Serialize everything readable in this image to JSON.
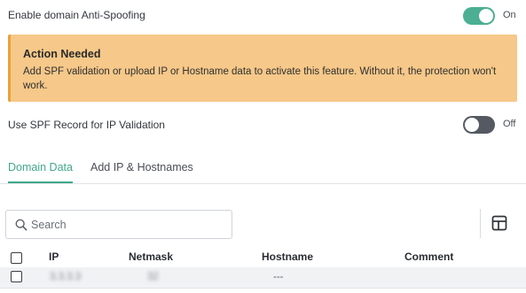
{
  "anti_spoofing": {
    "label": "Enable domain Anti-Spoofing",
    "state_text": "On",
    "enabled": true
  },
  "alert": {
    "title": "Action Needed",
    "body": "Add SPF validation or upload IP or Hostname data to activate this feature. Without it, the protection won't work."
  },
  "spf": {
    "label": "Use SPF Record for IP Validation",
    "state_text": "Off",
    "enabled": false
  },
  "tabs": [
    {
      "label": "Domain Data",
      "active": true
    },
    {
      "label": "Add IP & Hostnames",
      "active": false
    }
  ],
  "search": {
    "placeholder": "Search",
    "value": ""
  },
  "table": {
    "columns": [
      "IP",
      "Netmask",
      "Hostname",
      "Comment"
    ],
    "rows": [
      {
        "ip": "3.3.3.3",
        "netmask": "32",
        "hostname": "---",
        "comment": ""
      }
    ]
  },
  "colors": {
    "accent": "#4caf93",
    "alert_bg": "#f6c889",
    "alert_border": "#e8a23c",
    "toggle_off": "#555a62"
  },
  "icons": {
    "search": "search-icon",
    "columns": "table-columns-icon"
  }
}
